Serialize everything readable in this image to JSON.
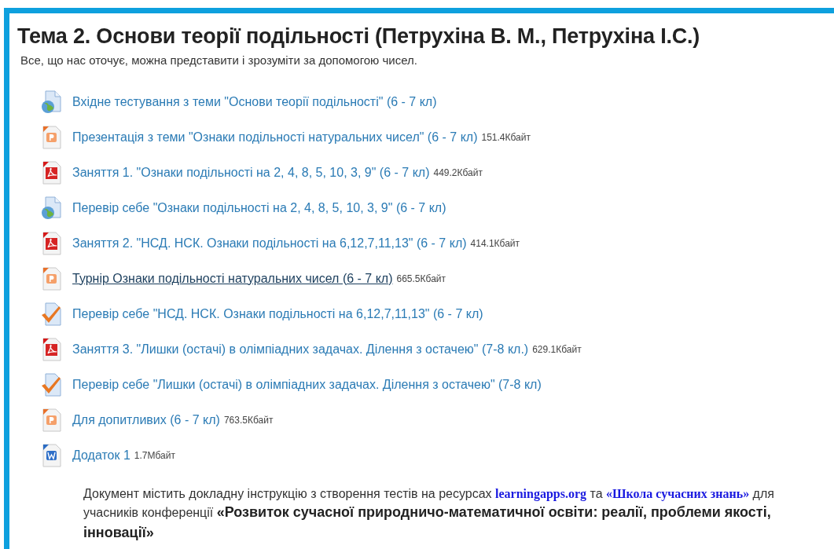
{
  "section": {
    "title": "Тема 2. Основи теорії подільності (Петрухіна В. М., Петрухіна І.С.)",
    "summary": "Все, що нас оточує, можна представити і зрозуміти за допомогою чисел."
  },
  "activities": [
    {
      "kind": "web",
      "label": "Вхідне тестування з теми \"Основи теорії подільності\" (6 - 7 кл)",
      "hovered": false
    },
    {
      "kind": "powerpoint",
      "label": "Презентація з теми \"Ознаки подільності натуральних чисел\" (6 - 7 кл)",
      "size": "151.4Кбайт",
      "hovered": false
    },
    {
      "kind": "pdf",
      "label": "Заняття 1. \"Ознаки подільності на 2, 4, 8, 5, 10, 3, 9\" (6 - 7 кл)",
      "size": "449.2Кбайт",
      "hovered": false
    },
    {
      "kind": "web",
      "label": "Перевір себе \"Ознаки подільності на 2, 4, 8, 5, 10, 3, 9\" (6 - 7 кл)",
      "hovered": false
    },
    {
      "kind": "pdf",
      "label": "Заняття 2. \"НСД. НСК. Ознаки подільності на 6,12,7,11,13\" (6 - 7 кл)",
      "size": "414.1Кбайт",
      "hovered": false
    },
    {
      "kind": "powerpoint",
      "label": "Турнір Ознаки подільності натуральних чисел (6 - 7 кл)",
      "size": "665.5Кбайт",
      "hovered": true
    },
    {
      "kind": "quiz",
      "label": "Перевір себе \"НСД. НСК. Ознаки подільності на 6,12,7,11,13\" (6 - 7 кл)",
      "hovered": false
    },
    {
      "kind": "pdf",
      "label": "Заняття 3. \"Лишки (остачі) в олімпіадних задачах. Ділення з остачею\" (7-8 кл.)",
      "size": "629.1Кбайт",
      "hovered": false
    },
    {
      "kind": "quiz",
      "label": "Перевір себе \"Лишки (остачі) в олімпіадних задачах. Ділення з остачею\" (7-8 кл)",
      "hovered": false
    },
    {
      "kind": "powerpoint",
      "label": "Для допитливих (6 - 7 кл)",
      "size": "763.5Кбайт",
      "hovered": false
    },
    {
      "kind": "word",
      "label": "Додаток 1",
      "size": "1.7Мбайт",
      "hovered": false
    }
  ],
  "note": [
    {
      "kind": "text",
      "text": "Документ містить докладну інструкцію з створення тестів на ресурсах "
    },
    {
      "kind": "link",
      "text": "learningapps.org"
    },
    {
      "kind": "text",
      "text": " та "
    },
    {
      "kind": "link",
      "text": "«Школа сучасних знань»"
    },
    {
      "kind": "text",
      "text": " для учасників конференції "
    },
    {
      "kind": "strong",
      "text": "«Розвиток сучасної природничо-математичної освіти: реалії, проблеми якості, інновації»"
    }
  ]
}
